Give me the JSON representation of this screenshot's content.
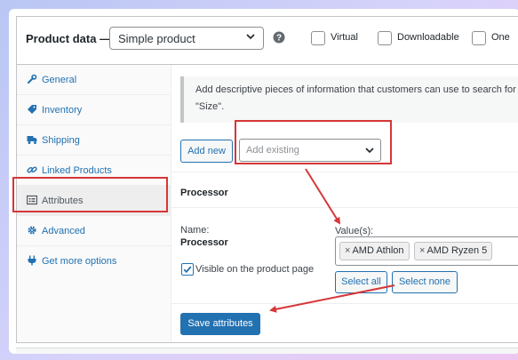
{
  "header": {
    "title": "Product data —",
    "product_type": "Simple product",
    "options": [
      {
        "label": "Virtual",
        "checked": false
      },
      {
        "label": "Downloadable",
        "checked": false
      },
      {
        "label": "One",
        "checked": false
      }
    ]
  },
  "sidebar": {
    "items": [
      {
        "label": "General",
        "icon": "wrench-icon",
        "active": false
      },
      {
        "label": "Inventory",
        "icon": "tag-icon",
        "active": false
      },
      {
        "label": "Shipping",
        "icon": "truck-icon",
        "active": false
      },
      {
        "label": "Linked Products",
        "icon": "link-icon",
        "active": false
      },
      {
        "label": "Attributes",
        "icon": "list-icon",
        "active": true
      },
      {
        "label": "Advanced",
        "icon": "gear-icon",
        "active": false
      },
      {
        "label": "Get more options",
        "icon": "plugin-icon",
        "active": false
      }
    ]
  },
  "main": {
    "notice_line1": "Add descriptive pieces of information that customers can use to search for",
    "notice_line2": "\"Size\".",
    "add_new": "Add new",
    "add_existing_placeholder": "Add existing",
    "attribute": {
      "heading": "Processor",
      "name_label": "Name:",
      "name_value": "Processor",
      "visible_label": "Visible on the product page",
      "visible_checked": true,
      "values_label": "Value(s):",
      "values": [
        "AMD Athlon",
        "AMD Ryzen 5"
      ],
      "select_all": "Select all",
      "select_none": "Select none"
    },
    "save": "Save attributes"
  },
  "colors": {
    "accent": "#2271b1",
    "annotation": "#d63638"
  }
}
